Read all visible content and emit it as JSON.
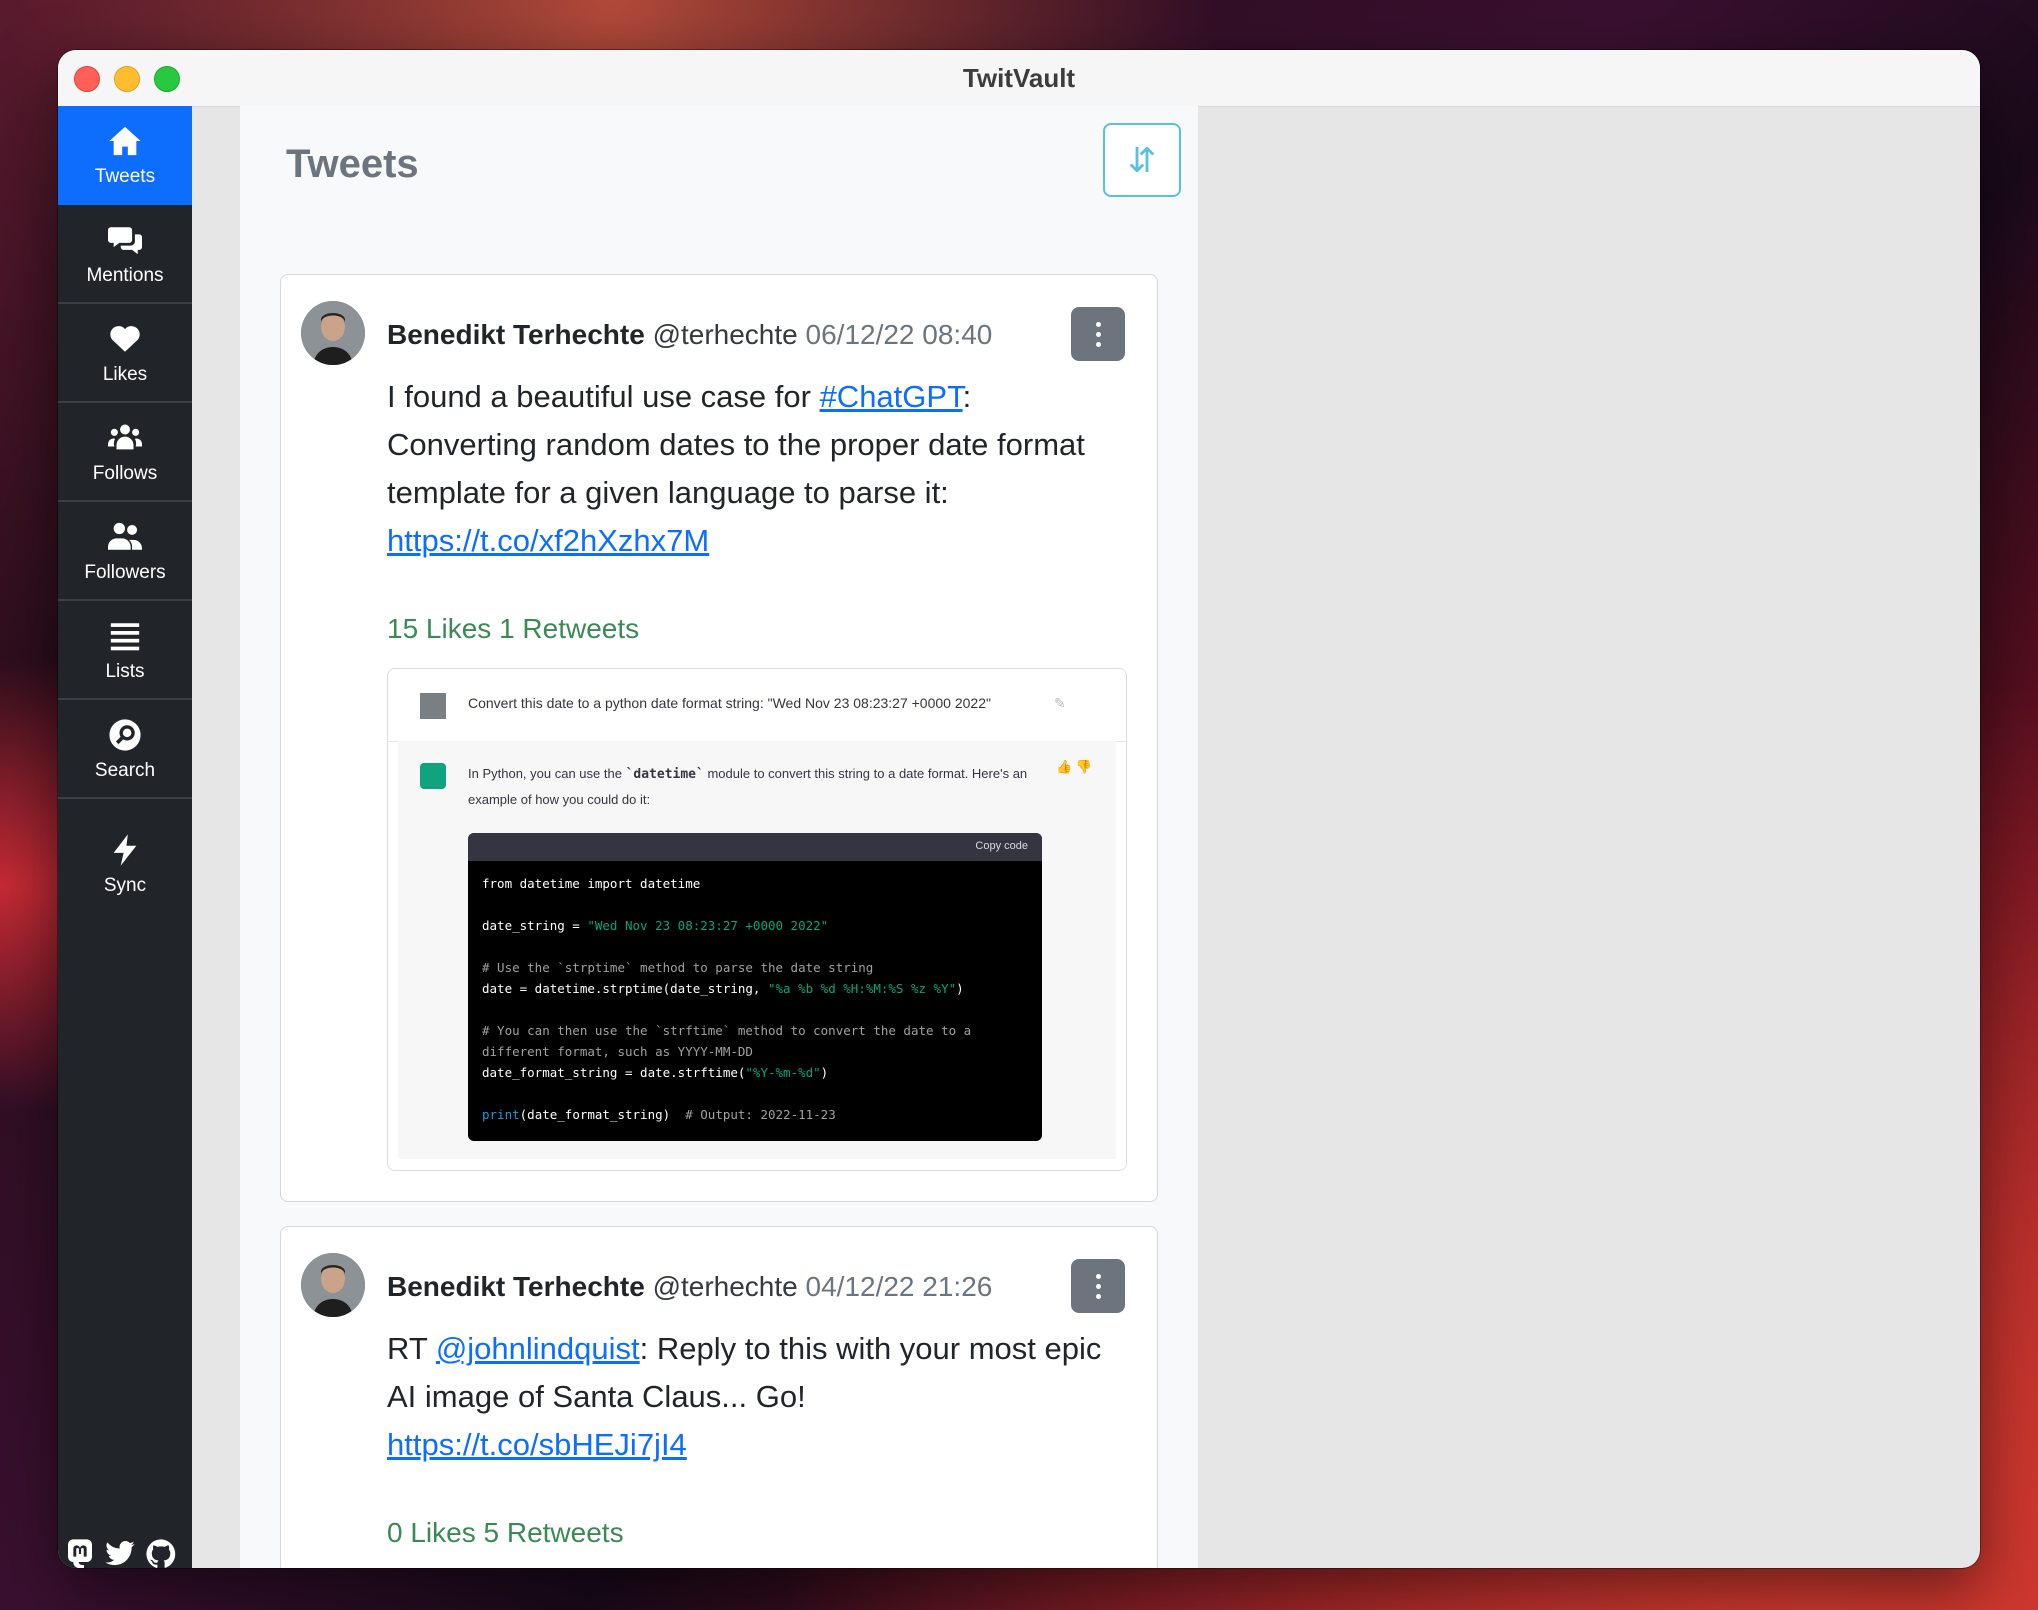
{
  "window": {
    "title": "TwitVault"
  },
  "sidebar": {
    "items": [
      {
        "label": "Tweets",
        "icon": "home-icon",
        "active": true
      },
      {
        "label": "Mentions",
        "icon": "comments-icon",
        "active": false
      },
      {
        "label": "Likes",
        "icon": "heart-icon",
        "active": false
      },
      {
        "label": "Follows",
        "icon": "users-icon",
        "active": false
      },
      {
        "label": "Followers",
        "icon": "user-friends-icon",
        "active": false
      },
      {
        "label": "Lists",
        "icon": "list-icon",
        "active": false
      },
      {
        "label": "Search",
        "icon": "search-icon",
        "active": false
      },
      {
        "label": "Sync",
        "icon": "bolt-icon",
        "active": false
      }
    ],
    "social": [
      "mastodon-icon",
      "twitter-icon",
      "github-icon"
    ]
  },
  "main": {
    "title": "Tweets",
    "sort_icon": "sort-icon",
    "tweets": [
      {
        "name": "Benedikt Terhechte",
        "handle": "@terhechte",
        "date": "06/12/22 08:40",
        "text_before": "I found a beautiful use case for ",
        "hashtag": "#ChatGPT",
        "text_after": ": Converting random dates to the proper date format template for a given language to parse it: ",
        "link": "https://t.co/xf2hXzhx7M",
        "stats": "15 Likes 1 Retweets",
        "media": {
          "question": "Convert this date to a python date format string: \"Wed Nov 23 08:23:27 +0000 2022\"",
          "answer_before": "In Python, you can use the ",
          "answer_code": "`datetime`",
          "answer_after": " module to convert this string to a date format. Here's an example of how you could do it:",
          "copy_label": "Copy code",
          "code": {
            "l1": "from datetime import datetime",
            "l2a": "date_string = ",
            "l2b": "\"Wed Nov 23 08:23:27 +0000 2022\"",
            "l3": "# Use the `strptime` method to parse the date string",
            "l4a": "date = datetime.strptime(date_string, ",
            "l4b": "\"%a %b %d %H:%M:%S %z %Y\"",
            "l4c": ")",
            "l5": "# You can then use the `strftime` method to convert the date to a",
            "l6": "different format, such as YYYY-MM-DD",
            "l7a": "date_format_string = date.strftime(",
            "l7b": "\"%Y-%m-%d\"",
            "l7c": ")",
            "l8a": "print",
            "l8b": "(date_format_string)  ",
            "l8c": "# Output: 2022-11-23"
          }
        }
      },
      {
        "name": "Benedikt Terhechte",
        "handle": "@terhechte",
        "date": "04/12/22 21:26",
        "text_before": "RT ",
        "mention": "@johnlindquist",
        "text_after": ": Reply to this with your most epic AI image of Santa Claus... Go! ",
        "link": "https://t.co/sbHEJi7jI4",
        "stats": "0 Likes 5 Retweets"
      }
    ]
  },
  "colors": {
    "accent": "#0d6efd",
    "sidebar": "#212529",
    "stats": "#3a8a55",
    "sort_border": "#5bc0de"
  }
}
